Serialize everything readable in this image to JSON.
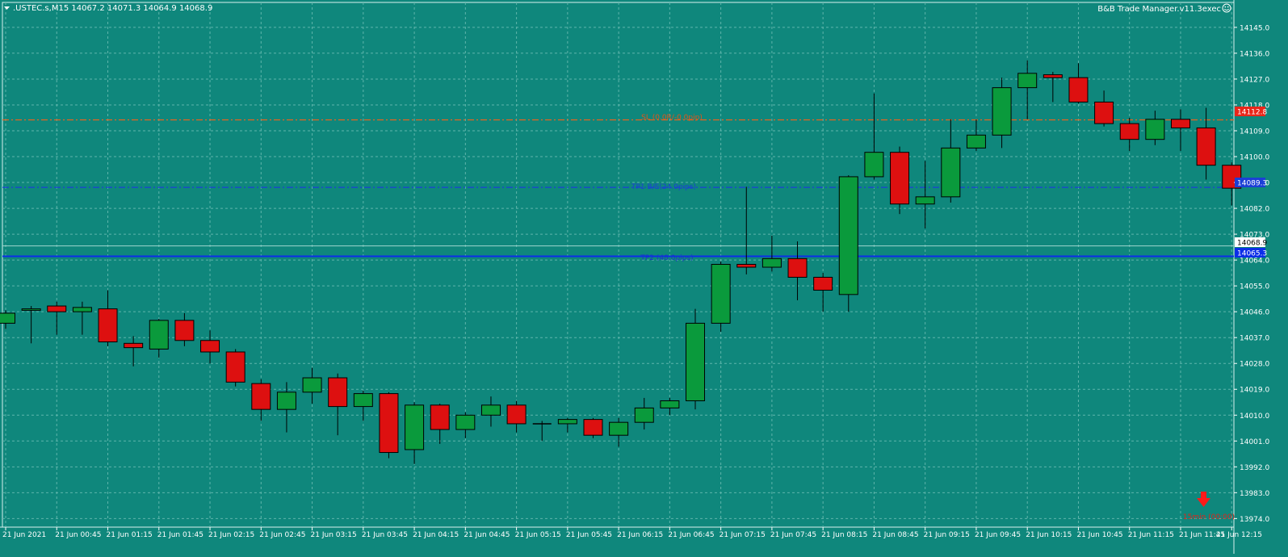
{
  "header": {
    "symbol_info": ".USTEC.s,M15  14067.2 14071.3 14064.9 14068.9",
    "ea_name": "B&B Trade Manager.v11.3exec"
  },
  "colors": {
    "background": "#0f877c",
    "grid": "#5fb5ab",
    "bull": "#0a9a3c",
    "bear": "#dd1010",
    "outline": "#000000",
    "sl_line": "#e8641e",
    "tp1_line": "#1b3fd6",
    "tp2_line": "#0c2ee8",
    "axis_text": "#ffffff"
  },
  "levels": {
    "sl": {
      "value": 14112.8,
      "label": "SL (0.0R/-0.0pip)",
      "price_tag": "14112.8"
    },
    "tp1": {
      "value": 14089.3,
      "label": "TP1 B/E(24.0pips)",
      "price_tag": "14089.3"
    },
    "tp2": {
      "value": 14065.3,
      "label": "TP2 (48.0pips)",
      "price_tag": "14065.3"
    },
    "bid": {
      "value": 14068.9,
      "price_tag": "14068.9"
    }
  },
  "timer_label": "15min (00:00)",
  "chart_data": {
    "type": "candlestick",
    "y_ticks": [
      "14145.0",
      "14136.0",
      "14127.0",
      "14118.0",
      "14109.0",
      "14100.0",
      "14091.0",
      "14082.0",
      "14073.0",
      "14064.0",
      "14055.0",
      "14046.0",
      "14037.0",
      "14028.0",
      "14019.0",
      "14010.0",
      "14001.0",
      "13992.0",
      "13983.0",
      "13974.0"
    ],
    "x_ticks": [
      "21 Jun 2021",
      "21 Jun 00:45",
      "21 Jun 01:15",
      "21 Jun 01:45",
      "21 Jun 02:15",
      "21 Jun 02:45",
      "21 Jun 03:15",
      "21 Jun 03:45",
      "21 Jun 04:15",
      "21 Jun 04:45",
      "21 Jun 05:15",
      "21 Jun 05:45",
      "21 Jun 06:15",
      "21 Jun 06:45",
      "21 Jun 07:15",
      "21 Jun 07:45",
      "21 Jun 08:15",
      "21 Jun 08:45",
      "21 Jun 09:15",
      "21 Jun 09:45",
      "21 Jun 10:15",
      "21 Jun 10:45",
      "21 Jun 11:15",
      "21 Jun 11:45",
      "21 Jun 12:15"
    ],
    "ylim": [
      13972.7,
      14147.5
    ],
    "candles": [
      [
        14042.0,
        14046.5,
        14040.0,
        14045.5
      ],
      [
        14046.5,
        14048.0,
        14035.0,
        14047.0
      ],
      [
        14048.0,
        14049.5,
        14038.0,
        14046.0
      ],
      [
        14046.0,
        14049.5,
        14038.0,
        14047.5
      ],
      [
        14047.0,
        14053.5,
        14034.0,
        14035.5
      ],
      [
        14035.0,
        14037.5,
        14027.0,
        14033.5
      ],
      [
        14033.0,
        14043.5,
        14030.0,
        14043.0
      ],
      [
        14043.0,
        14045.5,
        14034.0,
        14036.0
      ],
      [
        14036.0,
        14039.5,
        14028.0,
        14032.0
      ],
      [
        14032.0,
        14033.0,
        14020.0,
        14021.5
      ],
      [
        14021.0,
        14022.5,
        14008.0,
        14012.0
      ],
      [
        14012.0,
        14021.5,
        14004.0,
        14018.0
      ],
      [
        14018.0,
        14026.5,
        14014.0,
        14023.0
      ],
      [
        14023.0,
        14024.5,
        14003.0,
        14013.0
      ],
      [
        14013.0,
        14018.5,
        14008.0,
        14017.5
      ],
      [
        14017.5,
        14018.0,
        13995.0,
        13997.0
      ],
      [
        13998.0,
        14014.5,
        13993.0,
        14013.5
      ],
      [
        14013.5,
        14014.0,
        14000.0,
        14005.0
      ],
      [
        14005.0,
        14011.0,
        14002.0,
        14010.0
      ],
      [
        14010.0,
        14016.5,
        14006.0,
        14013.5
      ],
      [
        14013.5,
        14015.0,
        14004.0,
        14007.0
      ],
      [
        14007.0,
        14008.0,
        14001.0,
        14007.0
      ],
      [
        14007.0,
        14009.0,
        14004.0,
        14008.5
      ],
      [
        14008.5,
        14009.0,
        14002.0,
        14003.0
      ],
      [
        14003.0,
        14009.0,
        13999.0,
        14007.5
      ],
      [
        14007.5,
        14016.0,
        14005.0,
        14012.5
      ],
      [
        14012.5,
        14016.0,
        14010.0,
        14015.0
      ],
      [
        14015.0,
        14047.0,
        14012.0,
        14042.0
      ],
      [
        14042.0,
        14063.5,
        14039.0,
        14062.5
      ],
      [
        14062.5,
        14089.5,
        14059.0,
        14061.5
      ],
      [
        14061.5,
        14072.5,
        14060.0,
        14064.5
      ],
      [
        14064.5,
        14070.5,
        14050.0,
        14058.0
      ],
      [
        14058.0,
        14059.5,
        14046.0,
        14053.5
      ],
      [
        14052.0,
        14093.5,
        14046.0,
        14093.0
      ],
      [
        14093.0,
        14122.0,
        14092.0,
        14101.5
      ],
      [
        14101.5,
        14103.5,
        14080.0,
        14083.5
      ],
      [
        14083.5,
        14098.5,
        14075.0,
        14086.0
      ],
      [
        14086.0,
        14113.0,
        14084.0,
        14103.0
      ],
      [
        14103.0,
        14113.0,
        14102.0,
        14107.5
      ],
      [
        14107.5,
        14127.5,
        14103.0,
        14124.0
      ],
      [
        14124.0,
        14133.5,
        14113.0,
        14129.0
      ],
      [
        14128.5,
        14129.5,
        14119.0,
        14127.5
      ],
      [
        14127.5,
        14132.5,
        14118.5,
        14119.0
      ],
      [
        14119.0,
        14123.0,
        14110.5,
        14111.5
      ],
      [
        14111.5,
        14113.5,
        14102.0,
        14106.0
      ],
      [
        14106.0,
        14116.0,
        14104.0,
        14113.0
      ],
      [
        14113.0,
        14116.5,
        14102.0,
        14110.0
      ],
      [
        14110.0,
        14117.0,
        14092.0,
        14097.0
      ],
      [
        14097.0,
        14098.0,
        14083.0,
        14089.0
      ]
    ]
  }
}
